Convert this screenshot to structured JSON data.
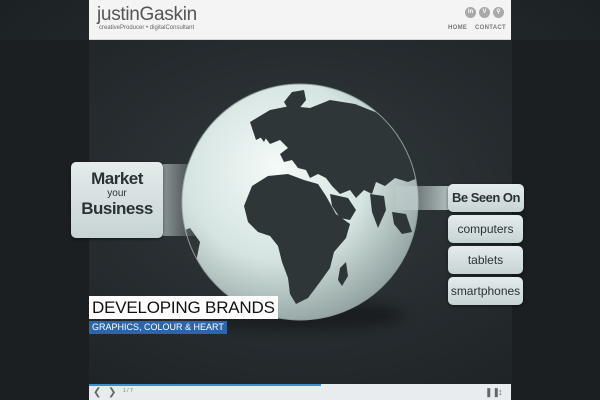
{
  "header": {
    "logo": "justinGaskin",
    "tagline": "creativeProducer • digitalConsultant",
    "social": [
      {
        "icon": "linkedin-icon",
        "label": "in"
      },
      {
        "icon": "vimeo-icon",
        "label": "V"
      },
      {
        "icon": "search-icon",
        "label": "⚲"
      }
    ],
    "nav": [
      "HOME",
      "CONTACT"
    ]
  },
  "slide": {
    "panel_left": {
      "line1": "Market",
      "line2": "your",
      "line3": "Business"
    },
    "panel_right_title": "Be Seen On",
    "devices": [
      "computers",
      "tablets",
      "smartphones"
    ],
    "caption_title": "DEVELOPING BRANDS",
    "caption_sub": "GRAPHICS, COLOUR & HEART"
  },
  "slider": {
    "prev": "❮",
    "next": "❯",
    "pager": "1 / 7",
    "pause": "❚❚",
    "fullscreen": "↕",
    "progress": 0.55
  },
  "colors": {
    "accent": "#3c8dd8",
    "caption_blue": "#2f64a8",
    "background": "#262c2f"
  }
}
